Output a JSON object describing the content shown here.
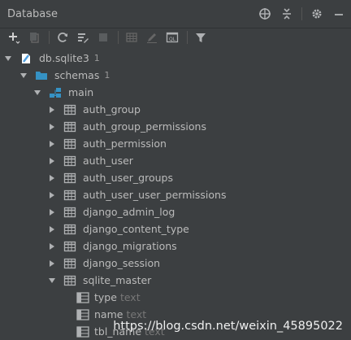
{
  "panel": {
    "title": "Database"
  },
  "title_icons": [
    "crosshair-icon",
    "collapse-all-icon",
    "gear-icon",
    "minimize-icon"
  ],
  "toolbar": [
    "add-icon",
    "duplicate-icon",
    "refresh-icon",
    "properties-icon",
    "stop-icon",
    "table-editor-icon",
    "edit-icon",
    "sql-console-icon",
    "filter-icon"
  ],
  "tree": {
    "database": {
      "label": "db.sqlite3",
      "count": "1"
    },
    "schemas": {
      "label": "schemas",
      "count": "1"
    },
    "schema": {
      "label": "main"
    },
    "tables": [
      "auth_group",
      "auth_group_permissions",
      "auth_permission",
      "auth_user",
      "auth_user_groups",
      "auth_user_user_permissions",
      "django_admin_log",
      "django_content_type",
      "django_migrations",
      "django_session",
      "sqlite_master"
    ],
    "columns": [
      {
        "name": "type",
        "type": "text"
      },
      {
        "name": "name",
        "type": "text"
      },
      {
        "name": "tbl_name",
        "type": "text"
      }
    ]
  },
  "watermark": "https://blog.csdn.net/weixin_45895022",
  "colors": {
    "background": "#3c3f41",
    "text": "#bbbbbb",
    "muted": "#777777",
    "icon": "#afb1b3",
    "folder": "#3592c4",
    "db": "#4f9fe0"
  }
}
